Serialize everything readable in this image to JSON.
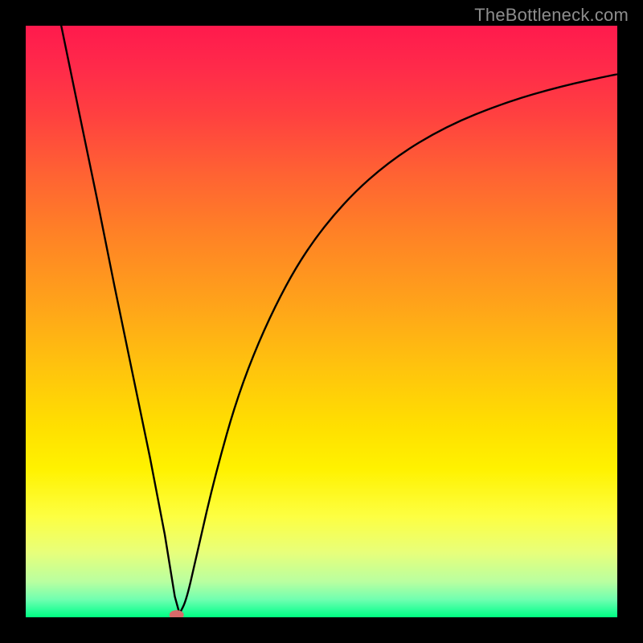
{
  "watermark": "TheBottleneck.com",
  "chart_data": {
    "type": "line",
    "title": "",
    "xlabel": "",
    "ylabel": "",
    "xlim": [
      0,
      1
    ],
    "ylim": [
      0,
      1
    ],
    "grid": false,
    "background_gradient": {
      "top_color": "#ff1a4d",
      "bottom_color": "#00ff80",
      "description": "Vertical red-to-green heat gradient; green near y=0 (optimum), red toward y=1."
    },
    "curve_description": "V-shaped bottleneck curve: steep near-linear descent from top-left to a minimum around x≈0.26, then a rising concave arc toward the upper right.",
    "minimum_point": {
      "x": 0.26,
      "y": 0.006
    },
    "marker": {
      "x": 0.255,
      "y": 0.004,
      "shape": "pill",
      "color": "#d86a6a"
    },
    "series": [
      {
        "name": "bottleneck-curve",
        "points": [
          {
            "x": 0.06,
            "y": 1.0
          },
          {
            "x": 0.09,
            "y": 0.855
          },
          {
            "x": 0.12,
            "y": 0.71
          },
          {
            "x": 0.15,
            "y": 0.56
          },
          {
            "x": 0.18,
            "y": 0.415
          },
          {
            "x": 0.21,
            "y": 0.27
          },
          {
            "x": 0.235,
            "y": 0.14
          },
          {
            "x": 0.252,
            "y": 0.035
          },
          {
            "x": 0.26,
            "y": 0.006
          },
          {
            "x": 0.272,
            "y": 0.03
          },
          {
            "x": 0.29,
            "y": 0.11
          },
          {
            "x": 0.32,
            "y": 0.24
          },
          {
            "x": 0.36,
            "y": 0.38
          },
          {
            "x": 0.41,
            "y": 0.505
          },
          {
            "x": 0.47,
            "y": 0.615
          },
          {
            "x": 0.54,
            "y": 0.705
          },
          {
            "x": 0.62,
            "y": 0.775
          },
          {
            "x": 0.71,
            "y": 0.83
          },
          {
            "x": 0.81,
            "y": 0.87
          },
          {
            "x": 0.905,
            "y": 0.898
          },
          {
            "x": 1.0,
            "y": 0.918
          }
        ]
      }
    ]
  }
}
